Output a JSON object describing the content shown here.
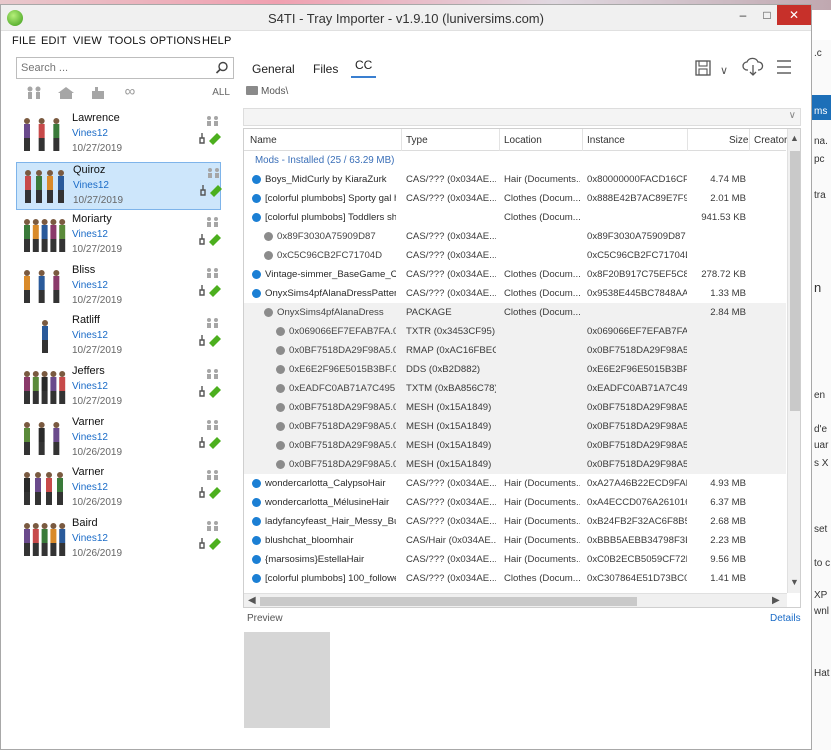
{
  "window": {
    "title": "S4TI - Tray Importer - v1.9.10  (luniversims.com)",
    "min_glyph": "–",
    "max_glyph": "□",
    "close_glyph": "✕"
  },
  "menu": [
    "FILE",
    "EDIT",
    "VIEW",
    "TOOLS",
    "OPTIONS",
    "HELP"
  ],
  "search": {
    "placeholder": "Search ..."
  },
  "filters": {
    "all_label": "ALL",
    "icons": [
      "sims-filter-icon",
      "household-filter-icon",
      "lot-filter-icon",
      "infinity-icon"
    ],
    "infinity_glyph": "∞"
  },
  "tray_items": [
    {
      "name": "Lawrence",
      "creator": "Vines12",
      "date": "10/27/2019",
      "selected": false
    },
    {
      "name": "Quiroz",
      "creator": "Vines12",
      "date": "10/27/2019",
      "selected": true
    },
    {
      "name": "Moriarty",
      "creator": "Vines12",
      "date": "10/27/2019",
      "selected": false
    },
    {
      "name": "Bliss",
      "creator": "Vines12",
      "date": "10/27/2019",
      "selected": false
    },
    {
      "name": "Ratliff",
      "creator": "Vines12",
      "date": "10/27/2019",
      "selected": false
    },
    {
      "name": "Jeffers",
      "creator": "Vines12",
      "date": "10/27/2019",
      "selected": false
    },
    {
      "name": "Varner",
      "creator": "Vines12",
      "date": "10/26/2019",
      "selected": false
    },
    {
      "name": "Varner",
      "creator": "Vines12",
      "date": "10/26/2019",
      "selected": false
    },
    {
      "name": "Baird",
      "creator": "Vines12",
      "date": "10/26/2019",
      "selected": false
    }
  ],
  "tabs": [
    "General",
    "Files",
    "CC"
  ],
  "active_tab": "CC",
  "toolbar": {
    "dropdown_glyph": "∨"
  },
  "breadcrumb": "Mods\\",
  "grid": {
    "columns": [
      "Name",
      "Type",
      "Location",
      "Instance",
      "Size",
      "Creator"
    ],
    "group_label": "Mods - Installed  (25 / 63.29 MB)",
    "rows": [
      {
        "level": 0,
        "dot": "blue",
        "name": "Boys_MidCurly by KiaraZurk",
        "type": "CAS/??? (0x034AE...",
        "location": "Hair (Documents...",
        "instance": "0x80000000FACD16CF",
        "size": "4.74 MB",
        "gray": false
      },
      {
        "level": 0,
        "dot": "blue",
        "name": "[colorful plumbobs] Sporty gal h...",
        "type": "CAS/??? (0x034AE...",
        "location": "Clothes (Docum...",
        "instance": "0x888E42B7AC89E7F9",
        "size": "2.01 MB",
        "gray": false
      },
      {
        "level": 0,
        "dot": "blue",
        "name": "[colorful plumbobs] Toddlers sho...",
        "type": "",
        "location": "Clothes (Docum...",
        "instance": "",
        "size": "941.53 KB",
        "gray": false
      },
      {
        "level": 1,
        "dot": "gray",
        "name": "0x89F3030A75909D87",
        "type": "CAS/??? (0x034AE...",
        "location": "",
        "instance": "0x89F3030A75909D87",
        "size": "",
        "gray": false
      },
      {
        "level": 1,
        "dot": "gray",
        "name": "0xC5C96CB2FC71704D",
        "type": "CAS/??? (0x034AE...",
        "location": "",
        "instance": "0xC5C96CB2FC71704D",
        "size": "",
        "gray": false
      },
      {
        "level": 0,
        "dot": "blue",
        "name": "Vintage-simmer_BaseGame_Chil...",
        "type": "CAS/??? (0x034AE...",
        "location": "Clothes (Docum...",
        "instance": "0x8F20B917C75EF5C8",
        "size": "278.72 KB",
        "gray": false
      },
      {
        "level": 0,
        "dot": "blue",
        "name": "OnyxSims4pfAlanaDressPatterns",
        "type": "CAS/??? (0x034AE...",
        "location": "Clothes (Docum...",
        "instance": "0x9538E445BC7848AA",
        "size": "1.33 MB",
        "gray": false
      },
      {
        "level": 1,
        "dot": "gray",
        "name": "OnyxSims4pfAlanaDress",
        "type": "PACKAGE",
        "location": "Clothes (Docum...",
        "instance": "",
        "size": "2.84 MB",
        "gray": true
      },
      {
        "level": 2,
        "dot": "gray",
        "name": "0x069066EF7EFAB7FA.0...",
        "type": "TXTR (0x3453CF95)",
        "location": "",
        "instance": "0x069066EF7EFAB7FA",
        "size": "",
        "gray": true
      },
      {
        "level": 2,
        "dot": "gray",
        "name": "0x0BF7518DA29F98A5.0...",
        "type": "RMAP (0xAC16FBEC)",
        "location": "",
        "instance": "0x0BF7518DA29F98A5",
        "size": "",
        "gray": true
      },
      {
        "level": 2,
        "dot": "gray",
        "name": "0xE6E2F96E5015B3BF.0...",
        "type": "DDS (0xB2D882)",
        "location": "",
        "instance": "0xE6E2F96E5015B3BF",
        "size": "",
        "gray": true
      },
      {
        "level": 2,
        "dot": "gray",
        "name": "0xEADFC0AB71A7C495....",
        "type": "TXTM (0xBA856C78)",
        "location": "",
        "instance": "0xEADFC0AB71A7C495",
        "size": "",
        "gray": true
      },
      {
        "level": 2,
        "dot": "gray",
        "name": "0x0BF7518DA29F98A5.0...",
        "type": "MESH (0x15A1849)",
        "location": "",
        "instance": "0x0BF7518DA29F98A5",
        "size": "",
        "gray": true
      },
      {
        "level": 2,
        "dot": "gray",
        "name": "0x0BF7518DA29F98A5.0...",
        "type": "MESH (0x15A1849)",
        "location": "",
        "instance": "0x0BF7518DA29F98A5",
        "size": "",
        "gray": true
      },
      {
        "level": 2,
        "dot": "gray",
        "name": "0x0BF7518DA29F98A5.0...",
        "type": "MESH (0x15A1849)",
        "location": "",
        "instance": "0x0BF7518DA29F98A5",
        "size": "",
        "gray": true
      },
      {
        "level": 2,
        "dot": "gray",
        "name": "0x0BF7518DA29F98A5.0...",
        "type": "MESH (0x15A1849)",
        "location": "",
        "instance": "0x0BF7518DA29F98A5",
        "size": "",
        "gray": true
      },
      {
        "level": 0,
        "dot": "blue",
        "name": "wondercarlotta_CalypsoHair",
        "type": "CAS/??? (0x034AE...",
        "location": "Hair (Documents...",
        "instance": "0xA27A46B22ECD9FAB",
        "size": "4.93 MB",
        "gray": false
      },
      {
        "level": 0,
        "dot": "blue",
        "name": "wondercarlotta_MélusineHair",
        "type": "CAS/??? (0x034AE...",
        "location": "Hair (Documents...",
        "instance": "0xA4ECCD076A261016",
        "size": "6.37 MB",
        "gray": false
      },
      {
        "level": 0,
        "dot": "blue",
        "name": "ladyfancyfeast_Hair_Messy_Bun",
        "type": "CAS/??? (0x034AE...",
        "location": "Hair (Documents...",
        "instance": "0xB24FB2F32AC6F8B5",
        "size": "2.68 MB",
        "gray": false
      },
      {
        "level": 0,
        "dot": "blue",
        "name": "blushchat_bloomhair",
        "type": "CAS/Hair (0x034AE...",
        "location": "Hair (Documents...",
        "instance": "0xBBB5AEBB34798F3E",
        "size": "2.23 MB",
        "gray": false
      },
      {
        "level": 0,
        "dot": "blue",
        "name": "{marsosims}EstellaHair",
        "type": "CAS/??? (0x034AE...",
        "location": "Hair (Documents...",
        "instance": "0xC0B2ECB5059CF72B",
        "size": "9.56 MB",
        "gray": false
      },
      {
        "level": 0,
        "dot": "blue",
        "name": "[colorful plumbobs] 100_follower...",
        "type": "CAS/??? (0x034AE...",
        "location": "Clothes (Docum...",
        "instance": "0xC307864E51D73BC0",
        "size": "1.41 MB",
        "gray": false
      }
    ]
  },
  "preview": {
    "label": "Preview",
    "details": "Details"
  },
  "colors": {
    "accent": "#1a6bc7",
    "dot_blue": "#1b7fd4",
    "dot_gray": "#8c8c8c",
    "selected_bg": "#cde6fb",
    "close_red": "#c7302a",
    "tool_green": "#4caf1e"
  },
  "background_window_text": [
    ".c",
    "ms",
    "na.",
    "pc",
    "tra",
    "n",
    "en",
    "d'e",
    "uar",
    "s X",
    "set",
    "to c",
    "XP",
    "wnl",
    "Hat"
  ]
}
